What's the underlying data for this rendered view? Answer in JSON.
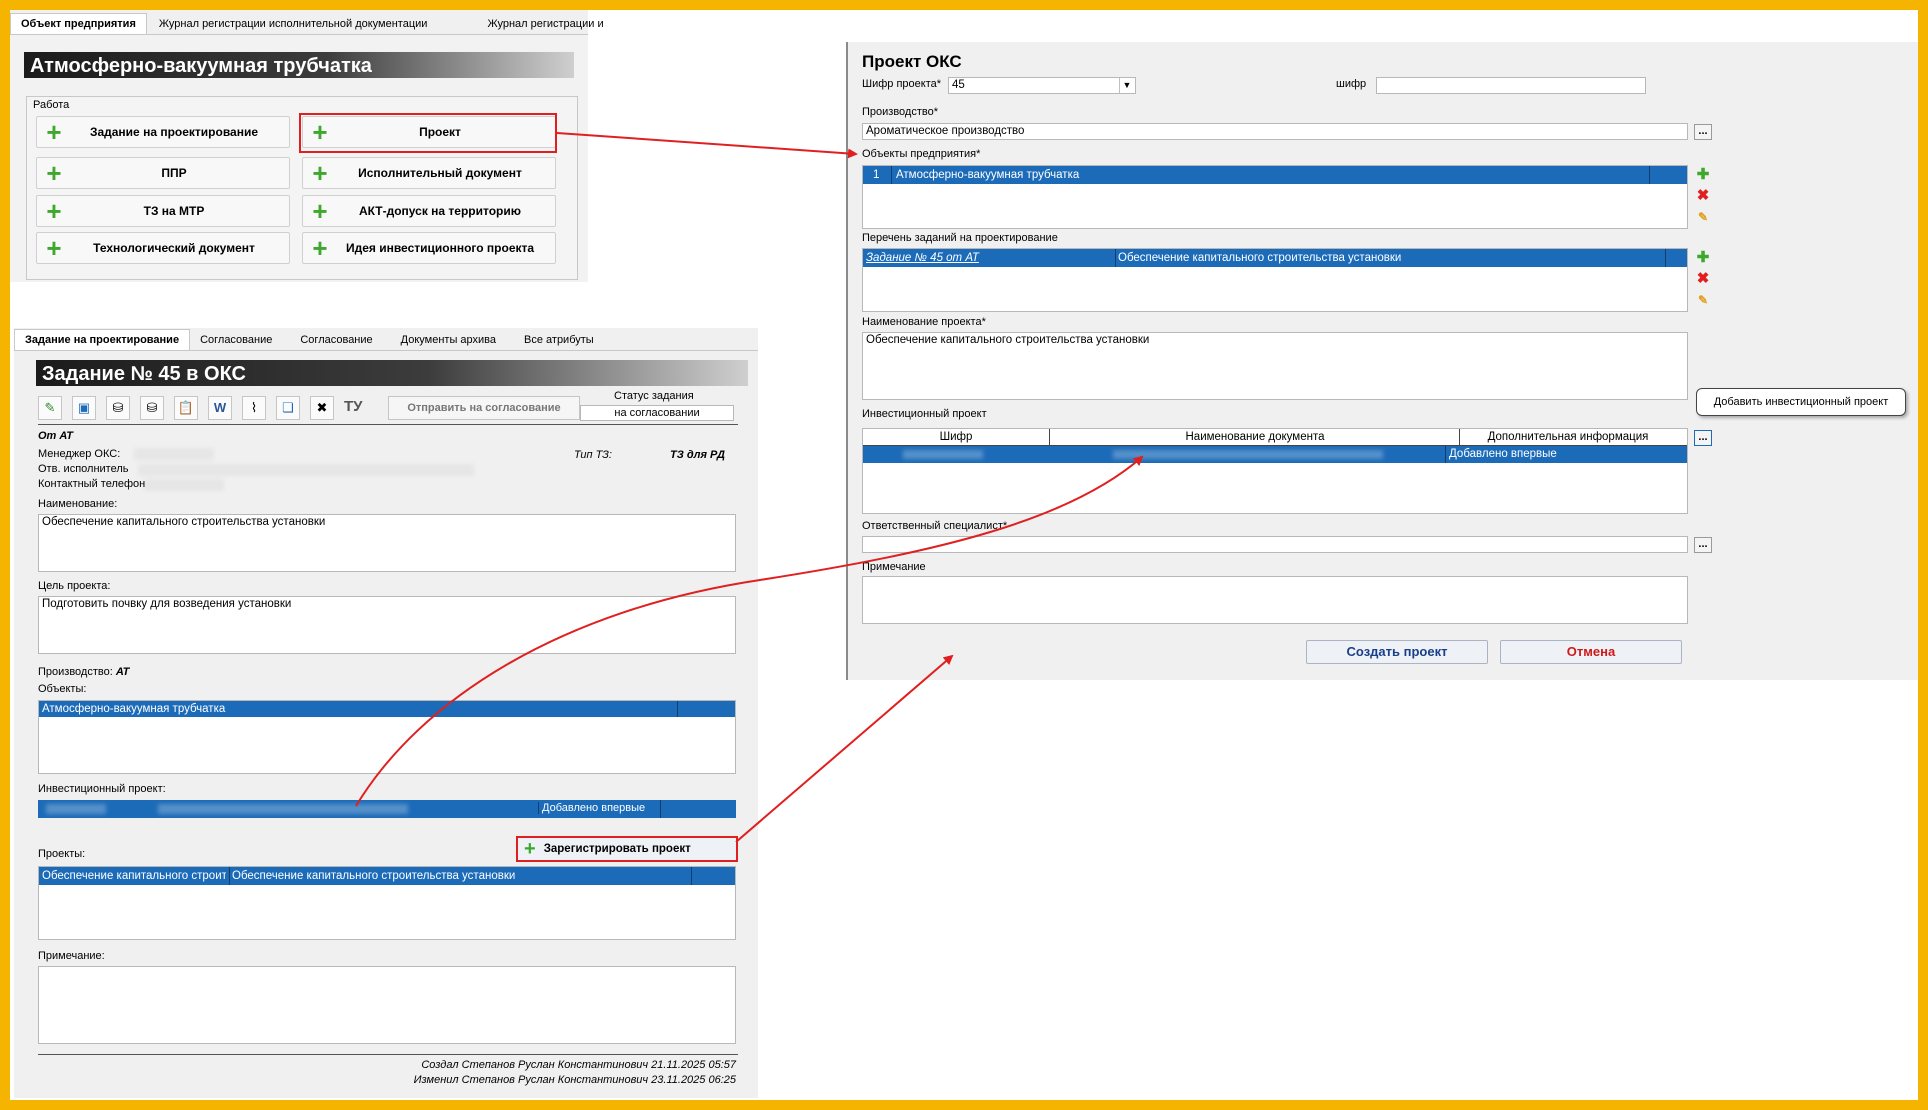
{
  "panel1": {
    "tabs": [
      "Объект предприятия",
      "Журнал регистрации исполнительной документации",
      "Журнал регистрации и"
    ],
    "title": "Атмосферно-вакуумная трубчатка",
    "group_label": "Работа",
    "buttons": [
      {
        "label": "Задание на проектирование"
      },
      {
        "label": "Проект"
      },
      {
        "label": "ППР"
      },
      {
        "label": "Исполнительный документ"
      },
      {
        "label": "ТЗ на МТР"
      },
      {
        "label": "АКТ-допуск на территорию"
      },
      {
        "label": "Технологический документ"
      },
      {
        "label": "Идея инвестиционного проекта"
      }
    ]
  },
  "panel2": {
    "tabs": [
      "Задание на проектирование",
      "Согласование",
      "Согласование",
      "Документы архива",
      "Все атрибуты"
    ],
    "title": "Задание № 45 в ОКС",
    "toolbar_tu": "ТУ",
    "send_label": "Отправить на согласование",
    "status_label": "Статус задания",
    "status_value": "на согласовании",
    "from_at": "От АТ",
    "manager_label": "Менеджер ОКС:",
    "executor_label": "Отв. исполнитель",
    "phone_label": "Контактный телефон",
    "tz_type_label": "Тип ТЗ:",
    "tz_type_value": "ТЗ для РД",
    "name_label": "Наименование:",
    "name_value": "Обеспечение капитального строительства установки",
    "goal_label": "Цель проекта:",
    "goal_value": "Подготовить почвку для возведения установки",
    "production_label": "Производство:",
    "production_value": "АТ",
    "objects_label": "Объекты:",
    "objects_row": "Атмосферно-вакуумная трубчатка",
    "invest_label": "Инвестиционный проект:",
    "invest_info": "Добавлено впервые",
    "register_label": "Зарегистрировать проект",
    "projects_label": "Проекты:",
    "projects_row": [
      "Обеспечение капитального строите",
      "Обеспечение капитального строительства установки"
    ],
    "note_label": "Примечание:",
    "created": "Создал Степанов Руслан Константинович 21.11.2025 05:57",
    "modified": "Изменил Степанов Руслан Константинович 23.11.2025 06:25"
  },
  "panel3": {
    "title": "Проект ОКС",
    "code_label": "Шифр проекта*",
    "code_value": "45",
    "shifr_label": "шифр",
    "production_label": "Производство*",
    "production_value": "Ароматическое производство",
    "objects_label": "Объекты предприятия*",
    "objects_row": {
      "num": "1",
      "name": "Атмосферно-вакуумная трубчатка"
    },
    "tasks_label": "Перечень заданий на проектирование",
    "tasks_row": {
      "link": "Задание № 45 от АТ",
      "name": "Обеспечение капитального строительства установки"
    },
    "project_name_label": "Наименование проекта*",
    "project_name_value": "Обеспечение капитального строительства установки",
    "invest_label": "Инвестиционный проект",
    "invest_columns": [
      "Шифр",
      "Наименование документа",
      "Дополнительная информация"
    ],
    "invest_row_info": "Добавлено впервые",
    "tooltip": "Добавить инвестиционный проект",
    "specialist_label": "Ответственный специалист*",
    "note_label": "Примечание",
    "create_label": "Создать проект",
    "cancel_label": "Отмена",
    "dots": "..."
  },
  "colors": {
    "frame": "#f5b400",
    "selection": "#1c6bb8",
    "accent_red": "#e02020",
    "plus_green": "#3da82c"
  }
}
